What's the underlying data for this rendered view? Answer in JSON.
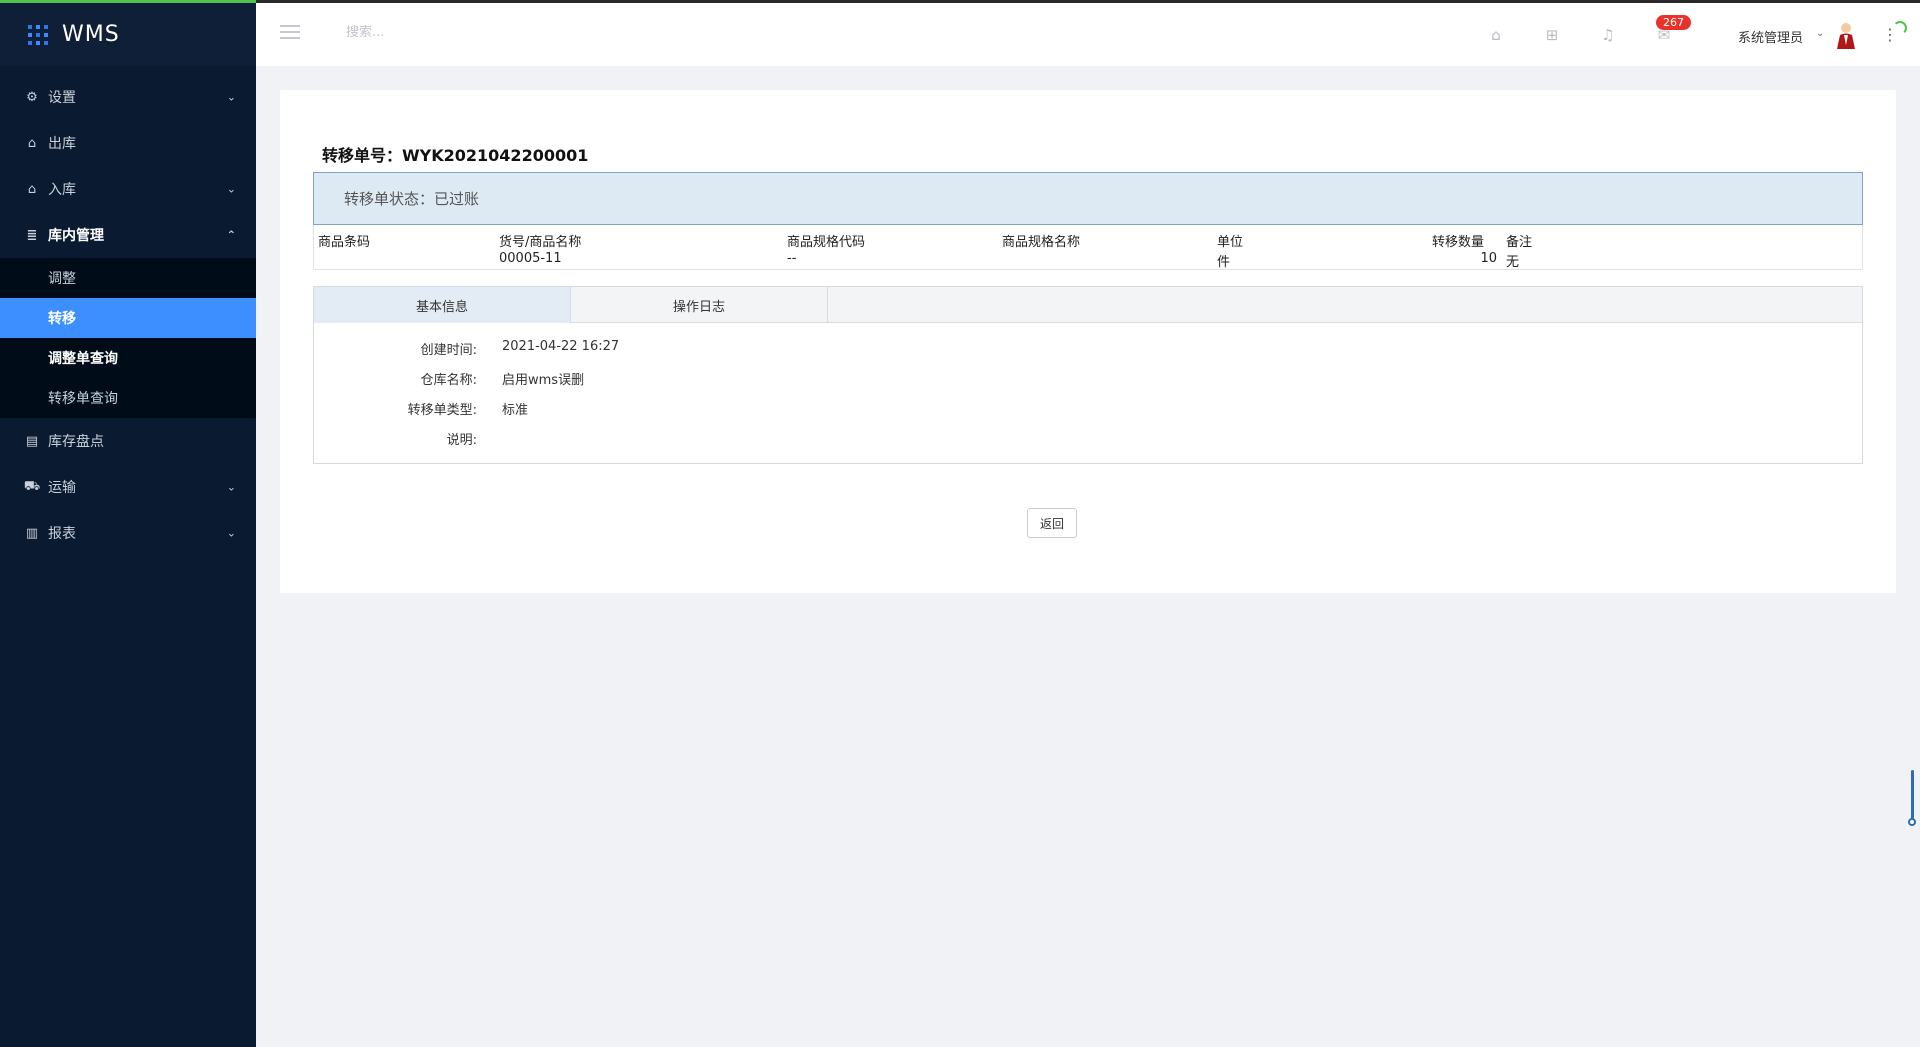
{
  "app": {
    "title": "WMS"
  },
  "sidebar": {
    "items": [
      {
        "label": "设置",
        "icon": "gear-icon",
        "has_children": true
      },
      {
        "label": "出库",
        "icon": "home-out-icon",
        "has_children": false
      },
      {
        "label": "入库",
        "icon": "home-in-icon",
        "has_children": true
      },
      {
        "label": "库内管理",
        "icon": "stack-icon",
        "has_children": true,
        "expanded": true
      },
      {
        "label": "库存盘点",
        "icon": "clipboard-icon",
        "has_children": false
      },
      {
        "label": "运输",
        "icon": "truck-icon",
        "has_children": true
      },
      {
        "label": "报表",
        "icon": "bar-chart-icon",
        "has_children": true
      }
    ],
    "subitems": [
      {
        "label": "调整"
      },
      {
        "label": "转移",
        "active": true
      },
      {
        "label": "调整单查询"
      },
      {
        "label": "转移单查询"
      }
    ]
  },
  "header": {
    "search_placeholder": "搜索...",
    "badge_count": "267",
    "user_name": "系统管理员"
  },
  "main": {
    "order_title": "转移单号：WYK2021042200001",
    "status_text": "转移单状态：已过账",
    "table": {
      "headers": [
        "商品条码",
        "货号/商品名称",
        "商品规格代码",
        "商品规格名称",
        "单位",
        "转移数量",
        "备注"
      ],
      "row": [
        "",
        "00005-11",
        "--",
        "",
        "件",
        "10",
        "无"
      ]
    },
    "tabs": [
      "基本信息",
      "操作日志"
    ],
    "info": [
      {
        "label": "创建时间:",
        "value": "2021-04-22 16:27"
      },
      {
        "label": "仓库名称:",
        "value": "启用wms误删"
      },
      {
        "label": "转移单类型:",
        "value": "标准"
      },
      {
        "label": "说明:",
        "value": ""
      }
    ],
    "back_label": "返回"
  },
  "colors": {
    "sidebar_bg": "#0a1a30",
    "active_item": "#3d8fff",
    "badge": "#e8332a",
    "status_bg": "#dde9f3"
  }
}
